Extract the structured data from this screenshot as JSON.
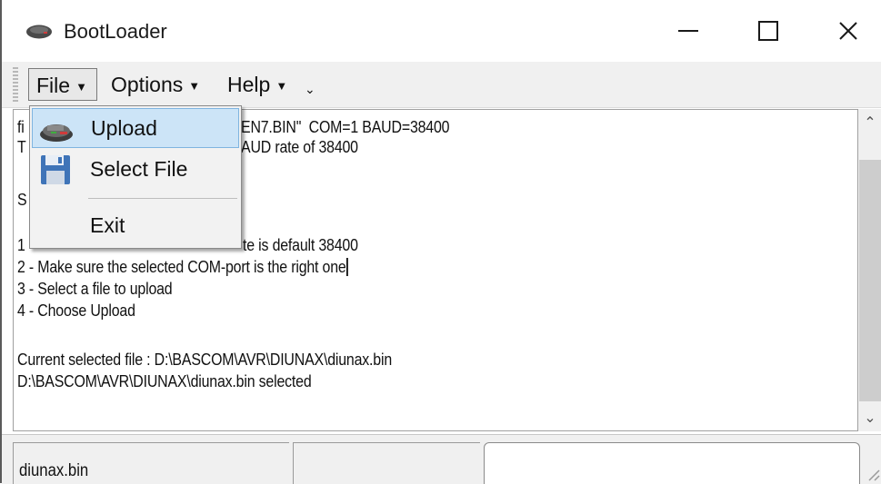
{
  "window": {
    "title": "BootLoader",
    "app_icon": "device-icon",
    "controls": {
      "minimize_icon": "minimize-icon",
      "maximize_icon": "maximize-icon",
      "close_glyph": "✕"
    }
  },
  "menubar": {
    "items": [
      {
        "label": "File",
        "caret": "▼"
      },
      {
        "label": "Options",
        "caret": "▼"
      },
      {
        "label": "Help",
        "caret": "▼"
      }
    ],
    "overflow_glyph": "⌄"
  },
  "file_menu": {
    "items": [
      {
        "label": "Upload",
        "icon": "chip-upload-icon",
        "highlighted": true
      },
      {
        "label": "Select File",
        "icon": "floppy-disk-icon"
      },
      {
        "label": "Exit"
      }
    ]
  },
  "log": {
    "lines": [
      "fi",
      "EN7.BIN\"  COM=1 BAUD=38400",
      "T",
      "AUD rate of 38400",
      "S",
      "1",
      "te is default 38400",
      "2 - Make sure the selected COM-port is the right one",
      "3 - Select a file to upload",
      "4 - Choose Upload",
      "Current selected file : D:\\BASCOM\\AVR\\DIUNAX\\diunax.bin",
      "D:\\BASCOM\\AVR\\DIUNAX\\diunax.bin selected"
    ]
  },
  "scrollbar": {
    "up_glyph": "⌃",
    "down_glyph": "⌄"
  },
  "statusbar": {
    "panels": [
      "diunax.bin",
      "",
      ""
    ]
  },
  "colors": {
    "highlight_bg": "#cce4f7",
    "highlight_border": "#7fb4e0",
    "menubar_bg": "#f0f0f0"
  }
}
